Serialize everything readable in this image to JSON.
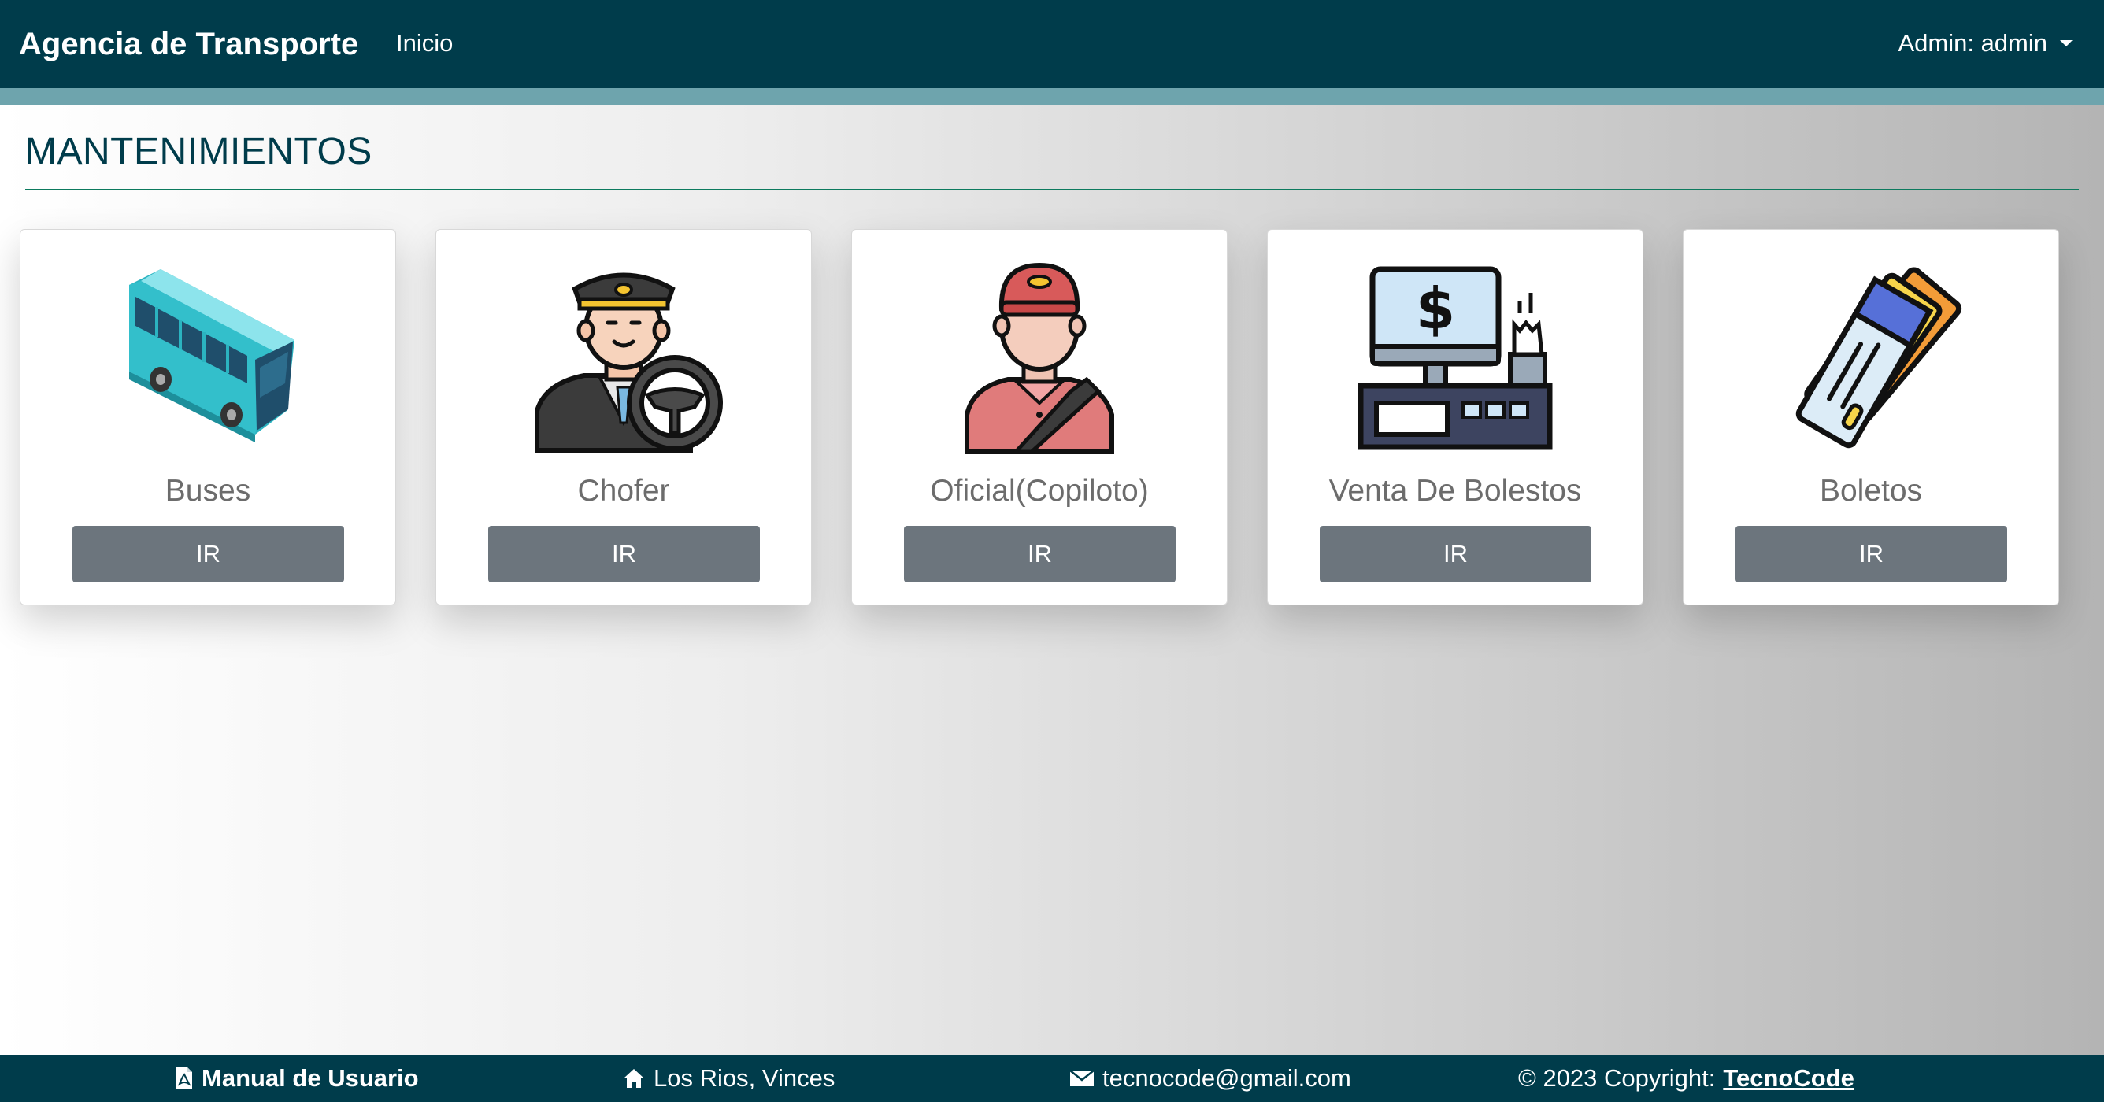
{
  "navbar": {
    "brand": "Agencia de Transporte",
    "home_link": "Inicio",
    "user_menu": "Admin: admin"
  },
  "section": {
    "title": "MANTENIMIENTOS"
  },
  "cards": [
    {
      "title": "Buses",
      "button": "IR",
      "icon": "bus-icon"
    },
    {
      "title": "Chofer",
      "button": "IR",
      "icon": "driver-icon"
    },
    {
      "title": "Oficial(Copiloto)",
      "button": "IR",
      "icon": "copilot-icon"
    },
    {
      "title": "Venta De Bolestos",
      "button": "IR",
      "icon": "cash-register-icon"
    },
    {
      "title": "Boletos",
      "button": "IR",
      "icon": "tickets-icon"
    }
  ],
  "footer": {
    "manual": "Manual de Usuario",
    "address": "Los Rios, Vinces",
    "email": "tecnocode@gmail.com",
    "copyright_prefix": "© 2023 Copyright:",
    "copyright_link": "TecnoCode"
  },
  "colors": {
    "navbar": "#003c4b",
    "accent_bar": "#6ea4ad",
    "button": "#6c757d",
    "rule": "#0c7a5e"
  }
}
